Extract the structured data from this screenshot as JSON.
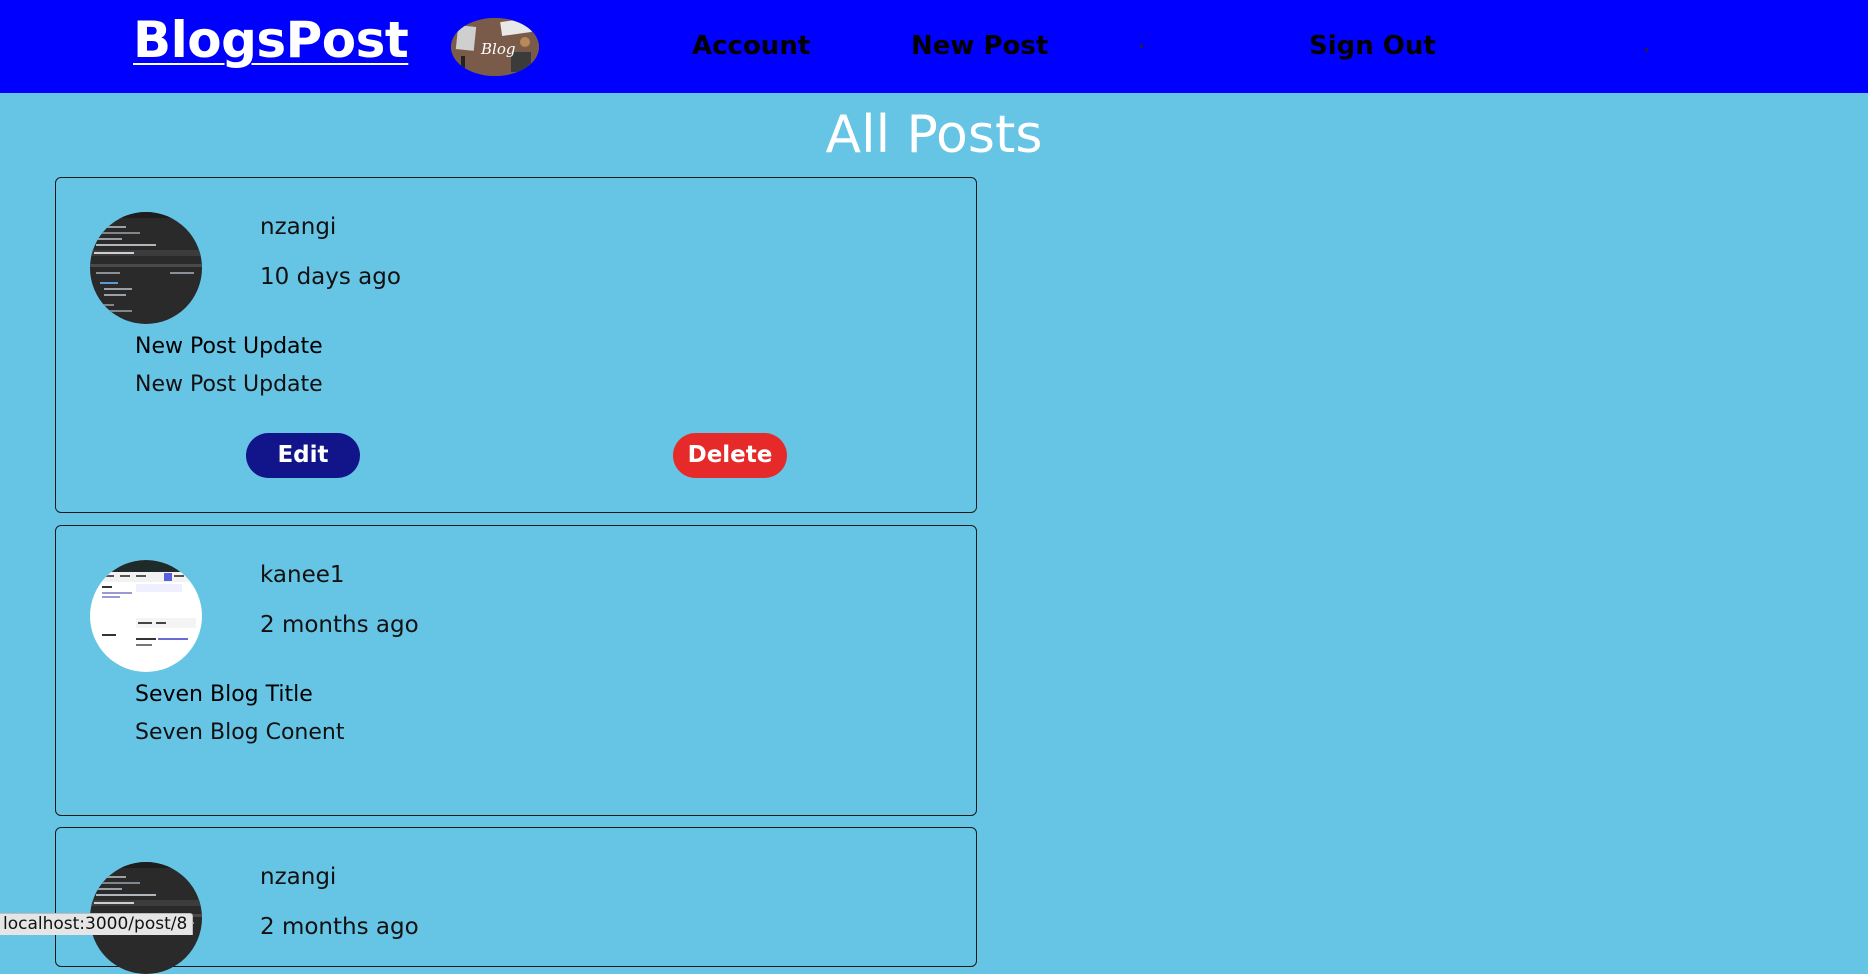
{
  "header": {
    "brand": "BlogsPost",
    "logo_text": "Blog",
    "nav": {
      "account": "Account",
      "new_post": "New Post",
      "sign_out": "Sign Out"
    },
    "colors": {
      "background": "#0000ff",
      "brand_text": "#ffffff",
      "nav_text": "#000000"
    }
  },
  "page": {
    "title": "All Posts",
    "background": "#66c4e4"
  },
  "posts": [
    {
      "author": "nzangi",
      "time": "10 days ago",
      "title": "New Post Update",
      "content": "New Post Update",
      "avatar": "dark-code-screenshot",
      "edit_label": "Edit",
      "delete_label": "Delete"
    },
    {
      "author": "kanee1",
      "time": "2 months ago",
      "title": "Seven Blog Title",
      "content": "Seven Blog Conent",
      "avatar": "light-ui-screenshot"
    },
    {
      "author": "nzangi",
      "time": "2 months ago",
      "avatar": "dark-code-screenshot"
    }
  ],
  "buttons": {
    "edit_color": "#12158a",
    "delete_color": "#e62a2a"
  },
  "status_bar": {
    "url": "localhost:3000/post/8"
  }
}
